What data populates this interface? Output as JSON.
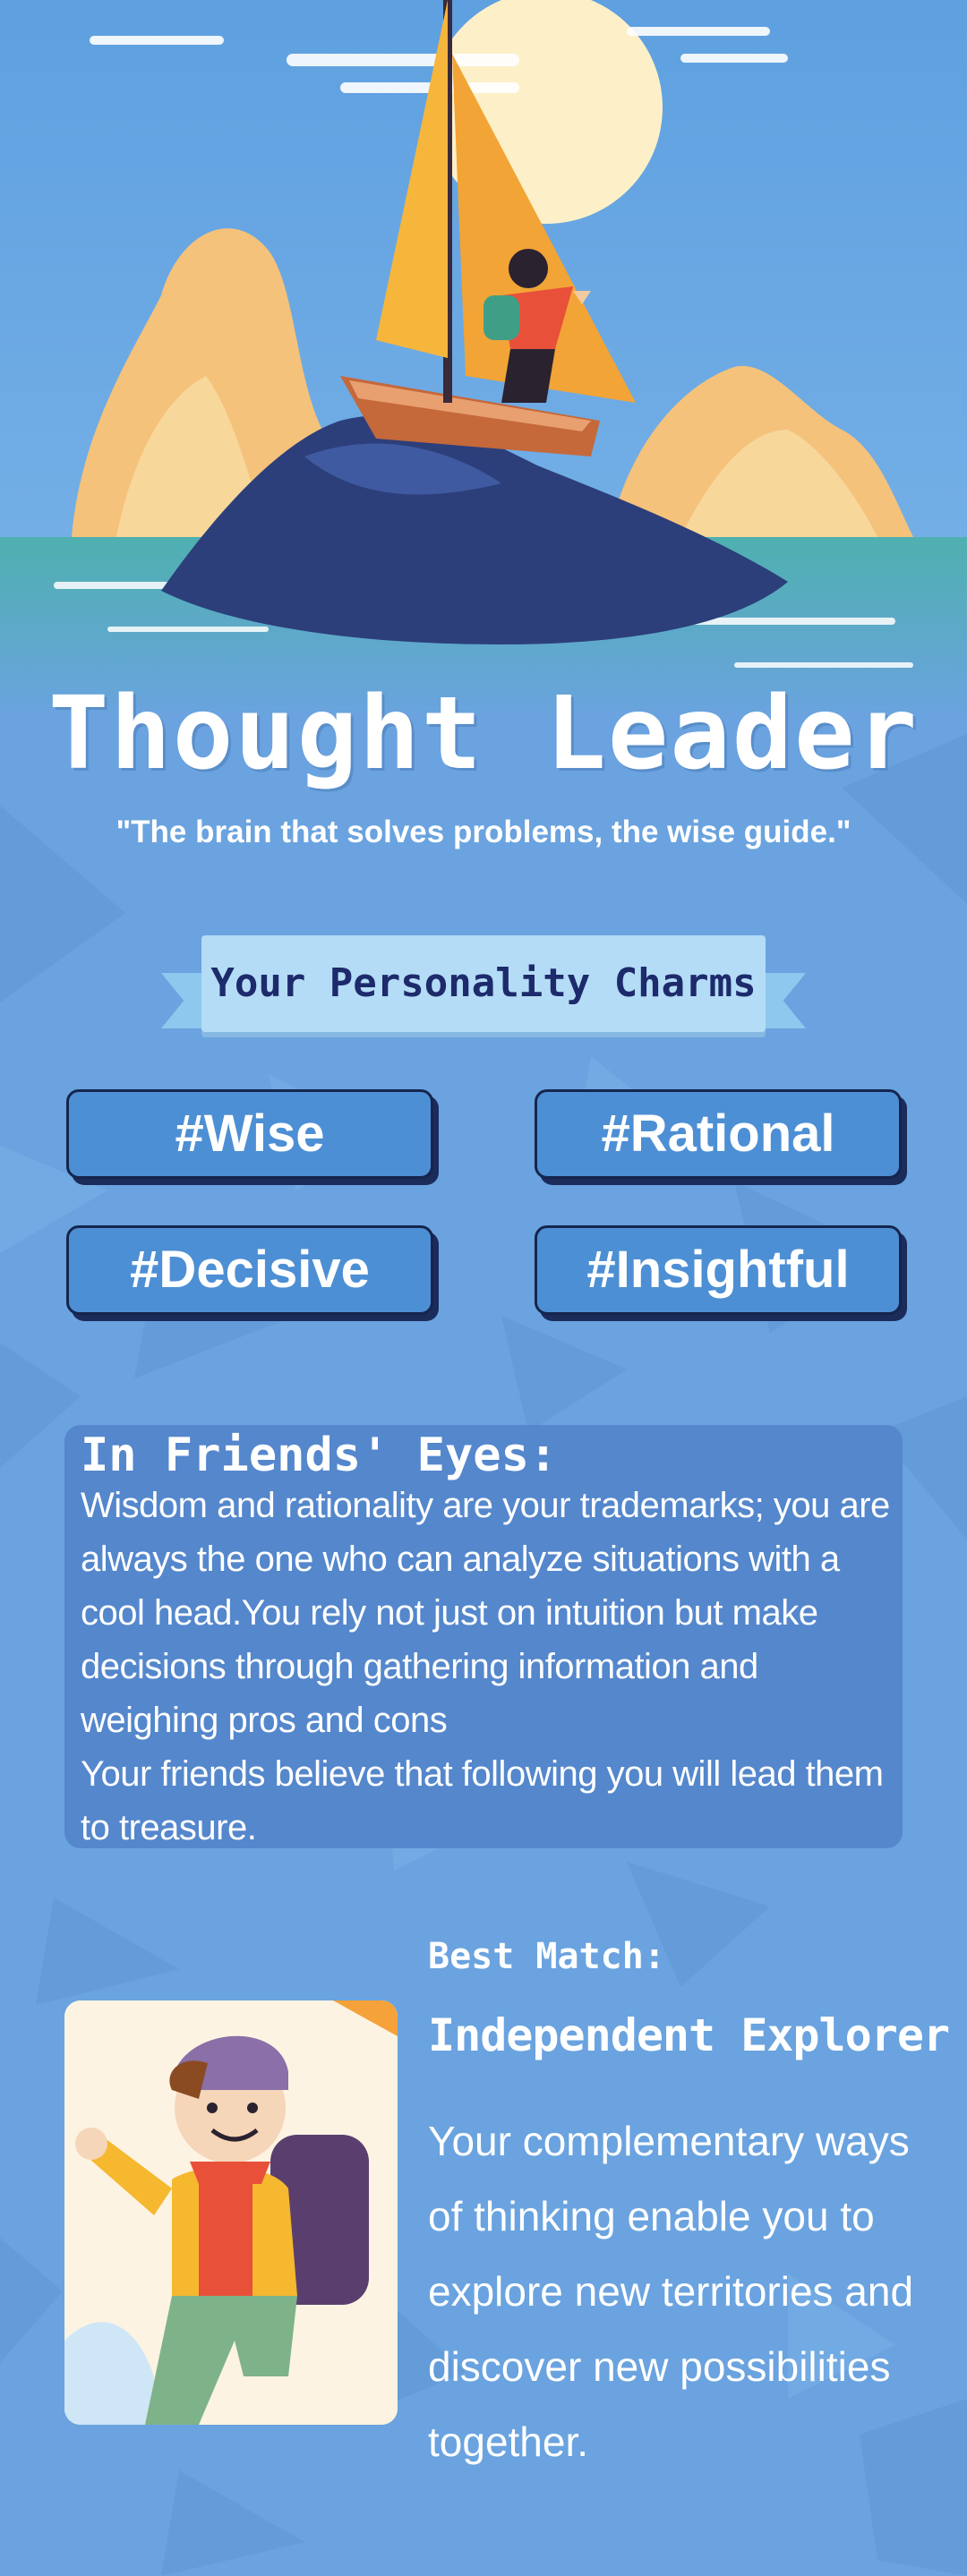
{
  "result": {
    "title": "Thought Leader",
    "tagline": "\"The brain that solves problems, the wise guide.\""
  },
  "charms": {
    "heading": "Your Personality Charms",
    "tags": [
      "#Wise",
      "#Rational",
      "#Decisive",
      "#Insightful"
    ]
  },
  "friends": {
    "heading": "In Friends' Eyes:",
    "paragraphs": [
      "Wisdom and rationality are your trademarks; you are always the one who can analyze situations with a cool head.You rely not just on intuition but make decisions through gathering information and weighing pros and cons",
      "Your friends believe that following you will lead them to treasure."
    ]
  },
  "best_match": {
    "label": "Best Match:",
    "name": "Independent Explorer",
    "description": "Your complementary ways of thinking enable you to explore new territories and discover new possibilities together."
  },
  "colors": {
    "background": "#6aa3df",
    "card": "#5487cc",
    "tag": "#4d8fd4",
    "banner": "#b4dcf6",
    "banner_text": "#1d2a6b",
    "sail": "#f6b63c"
  }
}
